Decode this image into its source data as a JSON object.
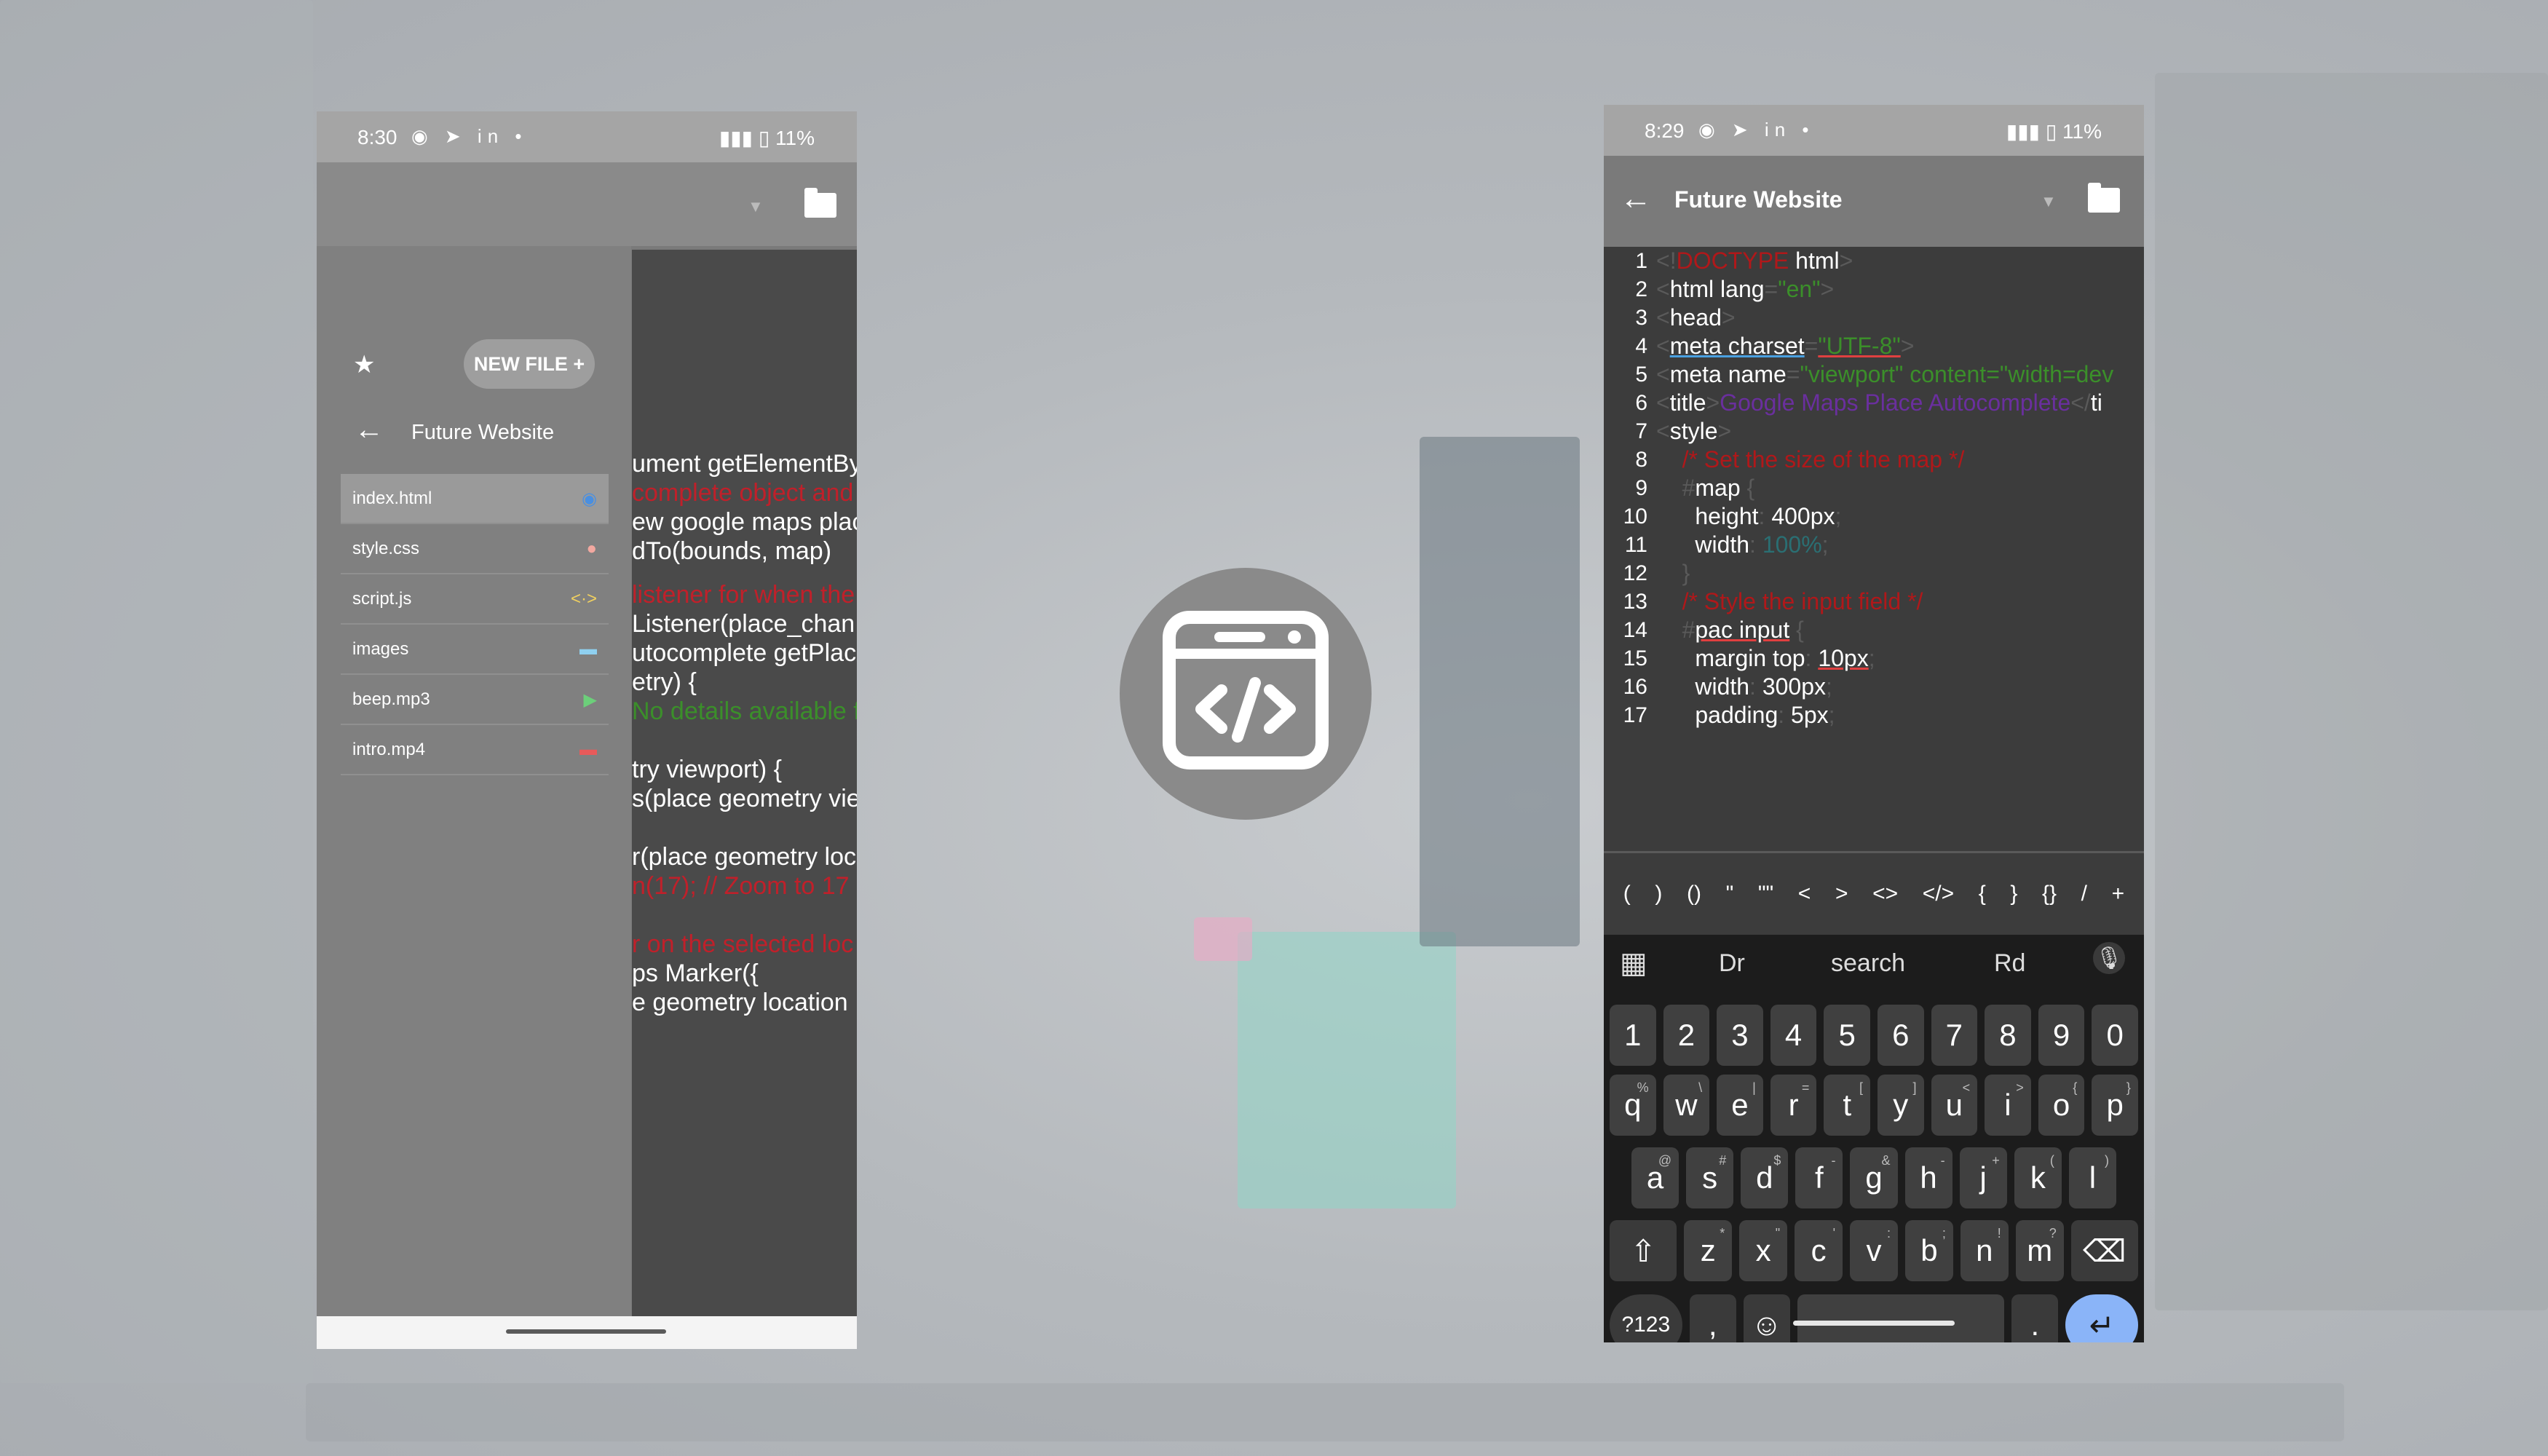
{
  "left_phone": {
    "status": {
      "time": "8:30",
      "apps": "◉ ➤ in •",
      "right": "▮▮▮ ▯ 11%"
    },
    "new_file_label": "NEW FILE +",
    "project_title": "Future Website",
    "files": [
      {
        "name": "index.html",
        "icon": "chrome-icon",
        "icon_glyph": "◉",
        "icon_color": "#4a8fe0"
      },
      {
        "name": "style.css",
        "icon": "palette-icon",
        "icon_glyph": "●",
        "icon_color": "#f2a8a0"
      },
      {
        "name": "script.js",
        "icon": "code-icon",
        "icon_glyph": "<·>",
        "icon_color": "#f0d060"
      },
      {
        "name": "images",
        "icon": "folder-icon",
        "icon_glyph": "▬",
        "icon_color": "#8fd0f0"
      },
      {
        "name": "beep.mp3",
        "icon": "play-icon",
        "icon_glyph": "▶",
        "icon_color": "#6ccf7a"
      },
      {
        "name": "intro.mp4",
        "icon": "film-icon",
        "icon_glyph": "▬",
        "icon_color": "#e85a5a"
      }
    ],
    "code_fragments": [
      {
        "text": "ument getElementByI",
        "color": "#ffffff"
      },
      {
        "text": "complete object and b",
        "color": "#c0202a"
      },
      {
        "text": "ew google maps place",
        "color": "#ffffff"
      },
      {
        "text": "dTo(bounds, map)",
        "color": "#ffffff"
      },
      {
        "text": "listener for when the",
        "color": "#c0202a"
      },
      {
        "text": "Listener(place_chan",
        "color": "#ffffff"
      },
      {
        "text": "utocomplete getPlace",
        "color": "#ffffff"
      },
      {
        "text": "etry) {",
        "color": "#ffffff"
      },
      {
        "text": "No details available f",
        "color": "#3b8f2a"
      },
      {
        "text": "try viewport) {",
        "color": "#ffffff"
      },
      {
        "text": "s(place geometry vie",
        "color": "#ffffff"
      },
      {
        "text": "r(place geometry loc",
        "color": "#ffffff"
      },
      {
        "text": "n(17); // Zoom to 17 if",
        "color": "#c0202a"
      },
      {
        "text": "r on the selected loc",
        "color": "#c0202a"
      },
      {
        "text": "ps Marker({",
        "color": "#ffffff"
      },
      {
        "text": "e geometry location",
        "color": "#ffffff"
      }
    ],
    "symbols": [
      "</>",
      "{",
      "}",
      "{}",
      "/",
      "+"
    ]
  },
  "right_phone": {
    "status": {
      "time": "8:29",
      "apps": "◉ ➤ in •",
      "right": "▮▮▮ ▯ 11%"
    },
    "project_title": "Future Website",
    "line_numbers": [
      "1",
      "2",
      "3",
      "4",
      "5",
      "6",
      "7",
      "8",
      "9",
      "10",
      "11",
      "12",
      "13",
      "14",
      "15",
      "16",
      "17"
    ],
    "code": {
      "l1a": "<!",
      "l1b": "DOCTYPE",
      "l1c": " html",
      "l1d": ">",
      "l2a": "<",
      "l2b": "html lang",
      "l2c": "=",
      "l2d": "\"en\"",
      "l2e": ">",
      "l3a": "<",
      "l3b": "head",
      "l3c": ">",
      "l4a": "  <",
      "l4b": "meta charset",
      "l4c": "=",
      "l4d": "\"UTF-8\"",
      "l4e": ">",
      "l5a": "  <",
      "l5b": "meta name",
      "l5c": "=",
      "l5d": "\"viewport\" content=\"width=dev",
      "l6a": "  <",
      "l6b": "title",
      "l6c": ">",
      "l6d": "Google Maps Place Autocomplete",
      "l6e": "</",
      "l6f": "ti",
      "l7a": "  <",
      "l7b": "style",
      "l7c": ">",
      "l8": "    /* Set the size of the map */",
      "l9a": "    #",
      "l9b": "map",
      "l9c": " {",
      "l10a": "      height",
      "l10b": ": ",
      "l10c": "400px",
      "l10d": ";",
      "l11a": "      width",
      "l11b": ": ",
      "l11c": "100%",
      "l11d": ";",
      "l12": "    }",
      "l13": "    /* Style the input field */",
      "l14a": "    #",
      "l14b": "pac input",
      "l14c": " {",
      "l15a": "      margin top",
      "l15b": ": ",
      "l15c": "10px",
      "l15d": ";",
      "l16a": "      width",
      "l16b": ": ",
      "l16c": "300px",
      "l16d": ";",
      "l17a": "      padding",
      "l17b": ": ",
      "l17c": "5px",
      "l17d": ";"
    },
    "symbols": [
      "(",
      ")",
      "()",
      "\"",
      "\"\"",
      "<",
      ">",
      "<>",
      "</>",
      "{",
      "}",
      "{}",
      "/",
      "+"
    ],
    "keyboard": {
      "suggestions": [
        "Dr",
        "search",
        "Rd"
      ],
      "numbers": [
        "1",
        "2",
        "3",
        "4",
        "5",
        "6",
        "7",
        "8",
        "9",
        "0"
      ],
      "row1": [
        {
          "k": "q",
          "s": "%"
        },
        {
          "k": "w",
          "s": "\\"
        },
        {
          "k": "e",
          "s": "|"
        },
        {
          "k": "r",
          "s": "="
        },
        {
          "k": "t",
          "s": "["
        },
        {
          "k": "y",
          "s": "]"
        },
        {
          "k": "u",
          "s": "<"
        },
        {
          "k": "i",
          "s": ">"
        },
        {
          "k": "o",
          "s": "{"
        },
        {
          "k": "p",
          "s": "}"
        }
      ],
      "row2": [
        {
          "k": "a",
          "s": "@"
        },
        {
          "k": "s",
          "s": "#"
        },
        {
          "k": "d",
          "s": "$"
        },
        {
          "k": "f",
          "s": "-"
        },
        {
          "k": "g",
          "s": "&"
        },
        {
          "k": "h",
          "s": "-"
        },
        {
          "k": "j",
          "s": "+"
        },
        {
          "k": "k",
          "s": "("
        },
        {
          "k": "l",
          "s": ")"
        }
      ],
      "row3": [
        {
          "k": "z",
          "s": "*"
        },
        {
          "k": "x",
          "s": "\""
        },
        {
          "k": "c",
          "s": "'"
        },
        {
          "k": "v",
          "s": ":"
        },
        {
          "k": "b",
          "s": ";"
        },
        {
          "k": "n",
          "s": "!"
        },
        {
          "k": "m",
          "s": "?"
        }
      ],
      "shift": "⇧",
      "backspace": "⌫",
      "symbols_key": "?123",
      "comma": ",",
      "emoji": "☺",
      "period": ".",
      "enter": "↵",
      "collapse": "⌄"
    }
  },
  "center_logo": {
    "icon": "code-window-icon"
  }
}
